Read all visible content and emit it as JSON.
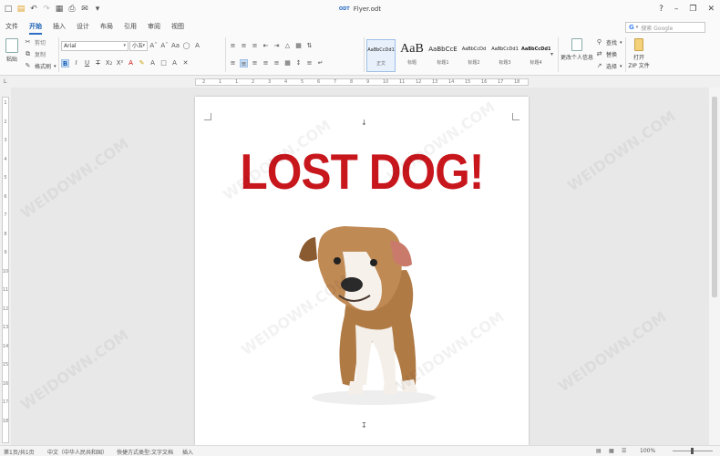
{
  "app": {
    "title": "Flyer.odt",
    "title_badge": "ODT"
  },
  "window_buttons": [
    "?",
    "–",
    "❐",
    "✕"
  ],
  "tabs": [
    {
      "label": "文件",
      "active": false
    },
    {
      "label": "开始",
      "active": true
    },
    {
      "label": "插入",
      "active": false
    },
    {
      "label": "设计",
      "active": false
    },
    {
      "label": "布局",
      "active": false
    },
    {
      "label": "引用",
      "active": false
    },
    {
      "label": "审阅",
      "active": false
    },
    {
      "label": "视图",
      "active": false
    }
  ],
  "search": {
    "placeholder": "搜索 Google",
    "engine_badge": "G"
  },
  "ribbon": {
    "clipboard": {
      "paste": "粘贴",
      "cut": "剪切",
      "copy": "复制",
      "format_painter": "格式刷"
    },
    "font": {
      "name": "Arial",
      "size": "小五"
    },
    "styles": [
      {
        "sample": "AaBbCcDd1",
        "name": "正文",
        "selected": true
      },
      {
        "sample": "AaB",
        "name": "标题",
        "selected": false
      },
      {
        "sample": "AaBbCcE",
        "name": "标题1",
        "selected": false
      },
      {
        "sample": "AaBbCcDd",
        "name": "标题2",
        "selected": false
      },
      {
        "sample": "AaBbCcDd1",
        "name": "标题3",
        "selected": false
      },
      {
        "sample": "AaBbCcDd1",
        "name": "标题4",
        "selected": false
      }
    ],
    "change_user": "更改个人信息",
    "find": "查找",
    "replace": "替换",
    "select": "选择",
    "open_zip": [
      "打开",
      "ZIP 文件"
    ]
  },
  "ruler": {
    "h_ticks": [
      "2",
      "1",
      "1",
      "2",
      "3",
      "4",
      "5",
      "6",
      "7",
      "8",
      "9",
      "10",
      "11",
      "12",
      "13",
      "14",
      "15",
      "16",
      "17",
      "18"
    ],
    "v_ticks": [
      "1",
      "2",
      "3",
      "4",
      "5",
      "6",
      "7",
      "8",
      "9",
      "10",
      "11",
      "12",
      "13",
      "14",
      "15",
      "16",
      "17",
      "18"
    ]
  },
  "document": {
    "headline": "LOST DOG!"
  },
  "statusbar": {
    "page": "第1页/共1页",
    "language": "中文（中华人民共和国）",
    "shortcut": "快捷方式类型:文字文档",
    "mode": "插入",
    "zoom": "100%"
  },
  "watermark": "WEIDOWN.COM",
  "colors": {
    "accent": "#2b6cc4",
    "headline": "#c8161d"
  }
}
